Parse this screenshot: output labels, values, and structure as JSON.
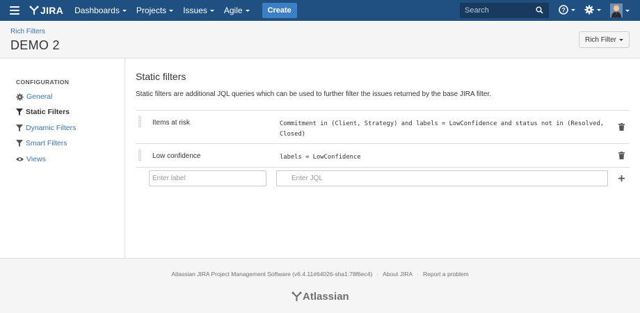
{
  "header": {
    "logo_text": "JIRA",
    "nav": [
      {
        "label": "Dashboards"
      },
      {
        "label": "Projects"
      },
      {
        "label": "Issues"
      },
      {
        "label": "Agile"
      }
    ],
    "create_label": "Create",
    "search_placeholder": "Search",
    "brand_color": "#205081"
  },
  "page_header": {
    "breadcrumb": "Rich Filters",
    "title": "DEMO 2",
    "rich_filter_label": "Rich Filter"
  },
  "sidebar": {
    "heading": "CONFIGURATION",
    "items": [
      {
        "label": "General",
        "icon": "gear-icon"
      },
      {
        "label": "Static Filters",
        "icon": "filter-icon",
        "active": true
      },
      {
        "label": "Dynamic Filters",
        "icon": "filter-icon"
      },
      {
        "label": "Smart Filters",
        "icon": "filter-icon"
      },
      {
        "label": "Views",
        "icon": "eye-icon"
      }
    ]
  },
  "main": {
    "title": "Static filters",
    "description": "Static filters are additional JQL queries which can be used to further filter the issues returned by the base JIRA filter.",
    "filters": [
      {
        "label": "Items at risk",
        "jql": "Commitment in (Client, Strategy) and labels = LowConfidence and status not in (Resolved, Closed)"
      },
      {
        "label": "Low confidence",
        "jql": "labels = LowConfidence"
      }
    ],
    "label_placeholder": "Enter label",
    "jql_placeholder": "Enter JQL"
  },
  "footer": {
    "version_text": "Atlassian JIRA Project Management Software (v6.4.11#64026-sha1:78f6ec4)",
    "about_label": "About JIRA",
    "report_label": "Report a problem",
    "logo_text": "Atlassian"
  }
}
